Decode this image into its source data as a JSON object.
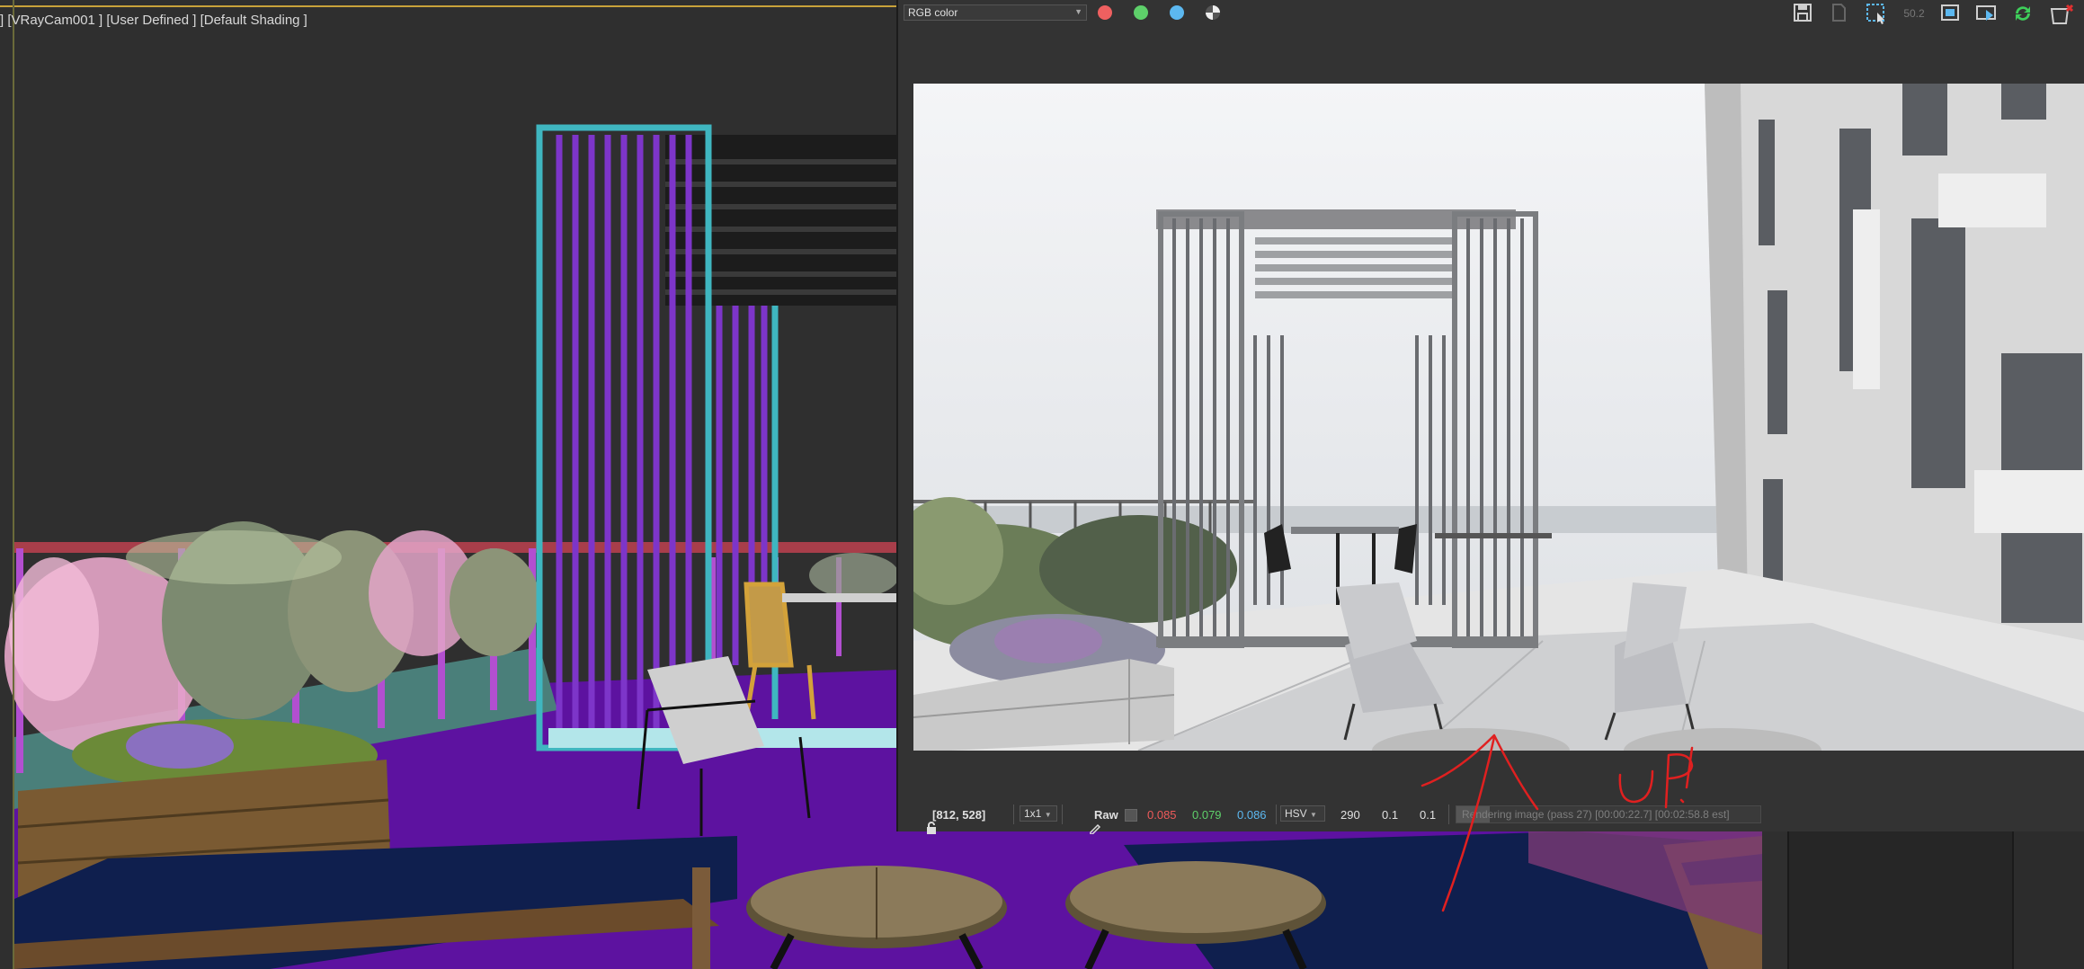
{
  "viewport": {
    "label": "] [VRayCam001 ] [User Defined ] [Default Shading ]"
  },
  "frame_buffer": {
    "channel": "RGB color",
    "channel_options_visible": [
      "RGB color"
    ],
    "toolbar_icons": [
      "save-icon",
      "save-all-icon",
      "region-render-icon",
      "zoom-value-icon",
      "track-mouse-icon",
      "render-history-icon",
      "refresh-icon",
      "clear-icon"
    ],
    "zoom_readout": "50.2",
    "status": {
      "coords": "[812, 528]",
      "sampling": "1x1",
      "raw_label": "Raw",
      "r_value": "0.085",
      "g_value": "0.079",
      "b_value": "0.086",
      "color_mode": "HSV",
      "h_value": "290",
      "s_value": "0.1",
      "v_value": "0.1",
      "progress_text": "Rendering image (pass 27) [00:00:22.7] [00:02:58.8 est]",
      "progress_fraction": 0.11
    }
  },
  "colors": {
    "red_channel": "#ef6060",
    "green_channel": "#5ed06a",
    "blue_channel": "#5cb8f0",
    "annotation_red": "#e02020",
    "selection_cyan": "#3fb6c0"
  },
  "annotation": {
    "text": "UP!"
  }
}
